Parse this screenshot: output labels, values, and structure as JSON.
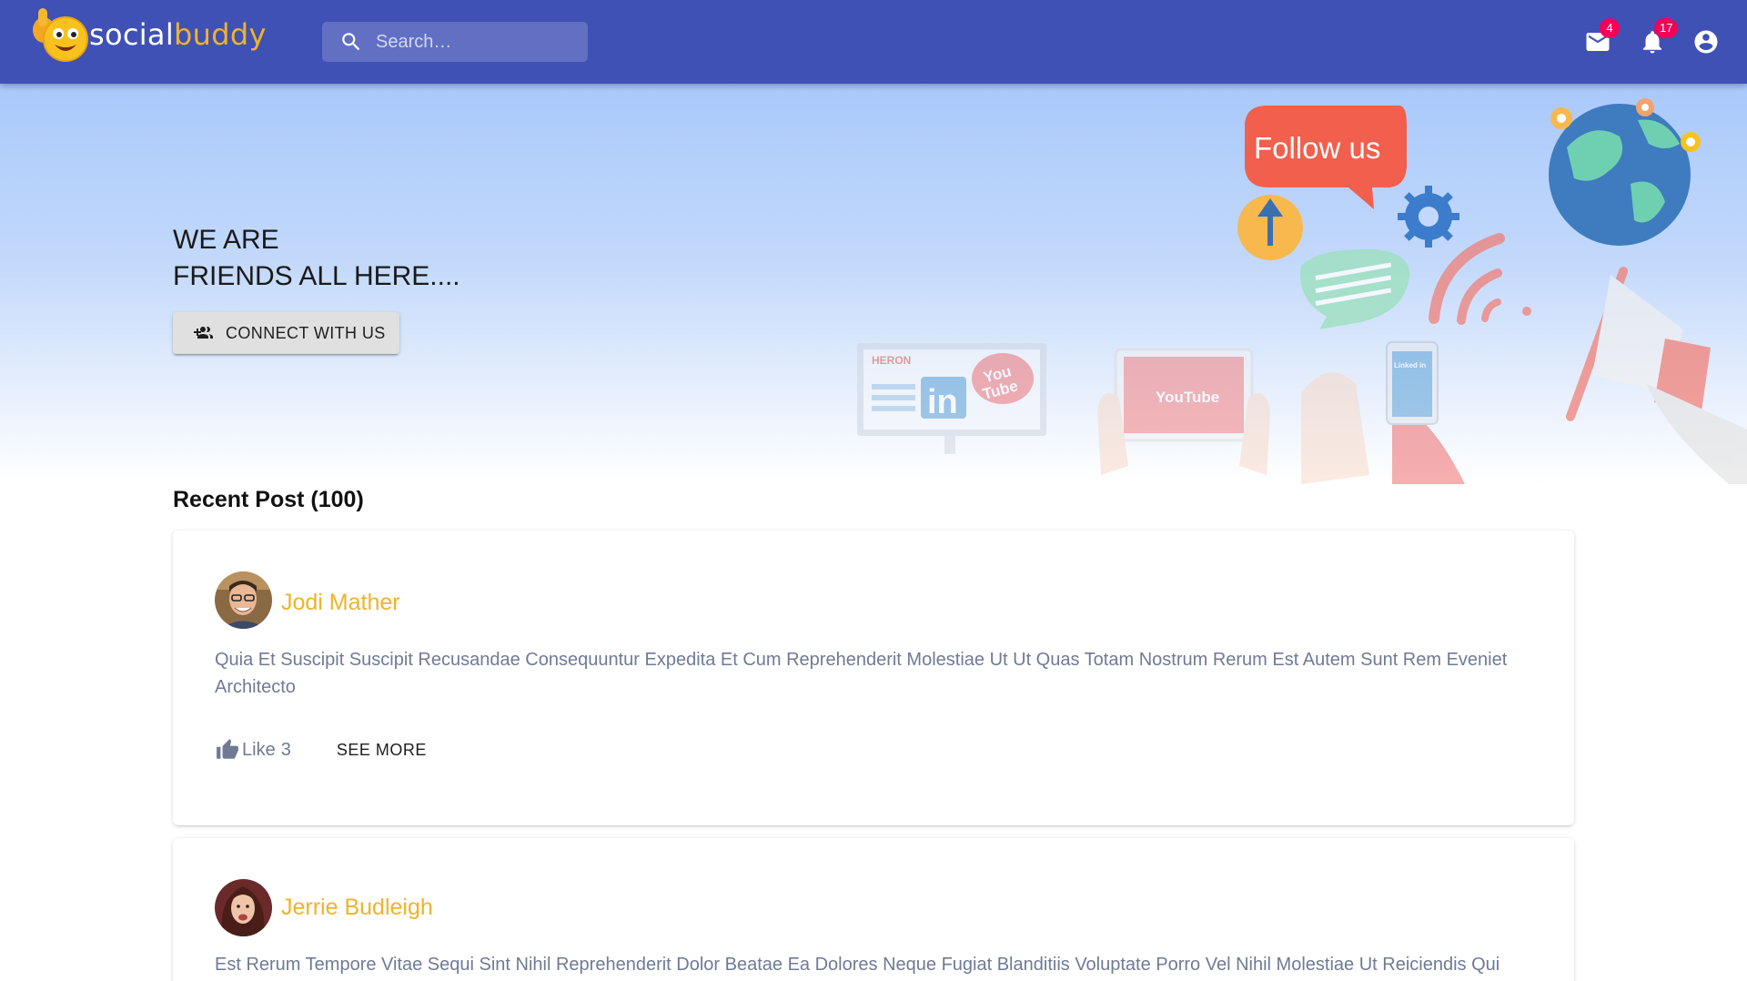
{
  "brand": {
    "name_part1": "social",
    "name_part2": "buddy"
  },
  "search": {
    "placeholder": "Search…"
  },
  "header_actions": {
    "mail_badge": "4",
    "notifications_badge": "17"
  },
  "hero": {
    "title_line1": "WE ARE",
    "title_line2": "FRIENDS ALL HERE....",
    "connect_label": "CONNECT WITH US",
    "art": {
      "speech_bubble": "Follow us",
      "monitor_brand": "HERON",
      "tablet_logo": "YouTube",
      "phone_logo": "Linked in"
    }
  },
  "recent_posts": {
    "title": "Recent Post (100)",
    "posts": [
      {
        "author": "Jodi Mather",
        "text": "Quia Et Suscipit Suscipit Recusandae Consequuntur Expedita Et Cum Reprehenderit Molestiae Ut Ut Quas Totam Nostrum Rerum Est Autem Sunt Rem Eveniet Architecto",
        "like_label": "Like",
        "like_count": "3",
        "see_more_label": "SEE MORE"
      },
      {
        "author": "Jerrie Budleigh",
        "text": "Est Rerum Tempore Vitae Sequi Sint Nihil Reprehenderit Dolor Beatae Ea Dolores Neque Fugiat Blanditiis Voluptate Porro Vel Nihil Molestiae Ut Reiciendis Qui"
      }
    ]
  },
  "colors": {
    "appbar": "#3f51b5",
    "accent": "#f0b32a",
    "badge": "#f50057",
    "body_text": "#707a95"
  }
}
